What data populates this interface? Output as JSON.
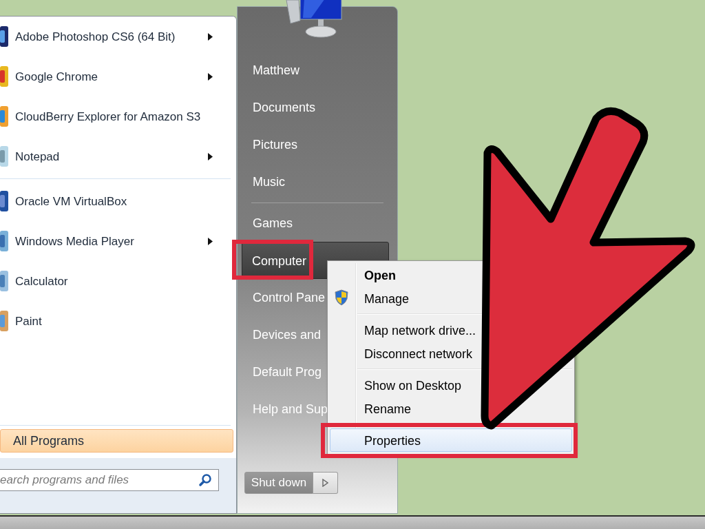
{
  "start_menu": {
    "program_groups": [
      {
        "items": [
          {
            "label": "Adobe Photoshop CS6 (64 Bit)",
            "submenu": true
          },
          {
            "label": "Google Chrome",
            "submenu": true
          },
          {
            "label": "CloudBerry Explorer for Amazon S3",
            "submenu": false
          },
          {
            "label": "Notepad",
            "submenu": true
          }
        ]
      },
      {
        "items": [
          {
            "label": "Oracle VM VirtualBox",
            "submenu": false
          },
          {
            "label": "Windows Media Player",
            "submenu": true
          },
          {
            "label": "Calculator",
            "submenu": false
          },
          {
            "label": "Paint",
            "submenu": false
          }
        ]
      }
    ],
    "all_programs": {
      "label": "All Programs",
      "selected": true
    },
    "search": {
      "placeholder": "earch programs and files"
    },
    "place_groups": [
      {
        "items": [
          {
            "label": "Matthew",
            "selected": false,
            "annotated": false
          },
          {
            "label": "Documents",
            "selected": false,
            "annotated": false
          },
          {
            "label": "Pictures",
            "selected": false,
            "annotated": false
          },
          {
            "label": "Music",
            "selected": false,
            "annotated": false
          }
        ]
      },
      {
        "items": [
          {
            "label": "Games",
            "selected": false,
            "annotated": false
          },
          {
            "label": "Computer",
            "selected": true,
            "annotated": true
          },
          {
            "label": "Control Pane",
            "selected": false,
            "annotated": false
          },
          {
            "label": "Devices and",
            "selected": false,
            "annotated": false
          },
          {
            "label": "Default Prog",
            "selected": false,
            "annotated": false
          },
          {
            "label": "Help and Sup",
            "selected": false,
            "annotated": false
          }
        ]
      }
    ],
    "shutdown": {
      "label": "Shut down"
    }
  },
  "context_menu": {
    "groups": [
      {
        "items": [
          {
            "label": "Open",
            "default": true,
            "shield": false,
            "selected": false,
            "annotated": false
          },
          {
            "label": "Manage",
            "default": false,
            "shield": true,
            "selected": false,
            "annotated": false
          }
        ]
      },
      {
        "items": [
          {
            "label": "Map network drive...",
            "default": false,
            "shield": false,
            "selected": false,
            "annotated": false
          },
          {
            "label": "Disconnect network",
            "default": false,
            "shield": false,
            "selected": false,
            "annotated": false
          }
        ]
      },
      {
        "items": [
          {
            "label": "Show on Desktop",
            "default": false,
            "shield": false,
            "selected": false,
            "annotated": false
          },
          {
            "label": "Rename",
            "default": false,
            "shield": false,
            "selected": false,
            "annotated": false
          }
        ]
      },
      {
        "items": [
          {
            "label": "Properties",
            "default": false,
            "shield": false,
            "selected": true,
            "annotated": true
          }
        ]
      }
    ]
  }
}
